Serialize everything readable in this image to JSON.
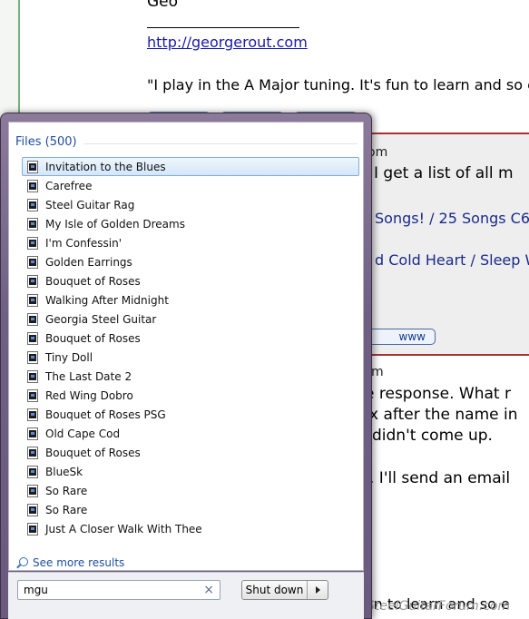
{
  "background_page": {
    "top_post": {
      "name": "Geo",
      "link": "http://georgerout.com",
      "quote": "\"I play in the A Major tuning. It's fun to learn and so e"
    },
    "post2": {
      "header_fragment": "om",
      "line1": "I get a list of all m",
      "line2": "Songs! / 25 Songs C6",
      "line3": "d Cold Heart / Sleep W",
      "www_button": "www"
    },
    "post3": {
      "header_fragment": "m",
      "line1": "e response. What r",
      "line2": "x after the name in",
      "line3": "didn't come up.",
      "line4": ". I'll send an email"
    },
    "bottom_fragment": "'s fun to learn and so e",
    "watermark": "SteelGuitarForum.com"
  },
  "start_menu": {
    "section_title": "Files (500)",
    "files": [
      {
        "label": "Invitation to the Blues",
        "selected": true
      },
      {
        "label": "Carefree"
      },
      {
        "label": "Steel Guitar Rag"
      },
      {
        "label": "My Isle of Golden Dreams"
      },
      {
        "label": "I'm Confessin'"
      },
      {
        "label": "Golden Earrings"
      },
      {
        "label": "Bouquet of Roses"
      },
      {
        "label": "Walking After Midnight"
      },
      {
        "label": "Georgia Steel Guitar"
      },
      {
        "label": "Bouquet of Roses"
      },
      {
        "label": "Tiny Doll"
      },
      {
        "label": "The Last Date 2"
      },
      {
        "label": "Red Wing Dobro"
      },
      {
        "label": "Bouquet of Roses PSG"
      },
      {
        "label": "Old Cape Cod"
      },
      {
        "label": "Bouquet of Roses"
      },
      {
        "label": "BlueSk"
      },
      {
        "label": "So Rare"
      },
      {
        "label": "So Rare"
      },
      {
        "label": "Just A Closer Walk With Thee"
      }
    ],
    "see_more": "See more results",
    "search": {
      "value": "mgu",
      "clear_glyph": "×"
    },
    "shutdown_label": "Shut down"
  }
}
